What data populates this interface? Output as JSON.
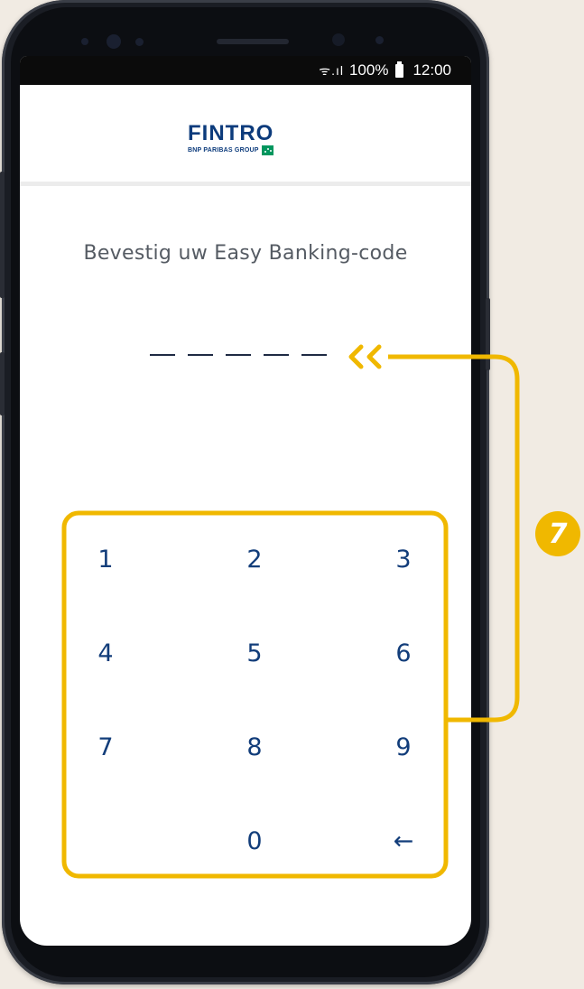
{
  "status_bar": {
    "battery": "100%",
    "time": "12:00",
    "signal": "ᯤ.ıl"
  },
  "header": {
    "brand": "FINTRO",
    "brand_sub": "BNP PARIBAS GROUP"
  },
  "title": "Bevestig uw Easy Banking-code",
  "pin": {
    "length": 5,
    "entered": 0
  },
  "keypad": {
    "keys": [
      "1",
      "2",
      "3",
      "4",
      "5",
      "6",
      "7",
      "8",
      "9",
      "0"
    ],
    "backspace": "←"
  },
  "annotation": {
    "badge": "7"
  },
  "colors": {
    "accent": "#f0b800",
    "brand": "#0c3b7c",
    "key_text": "#123d7a"
  }
}
